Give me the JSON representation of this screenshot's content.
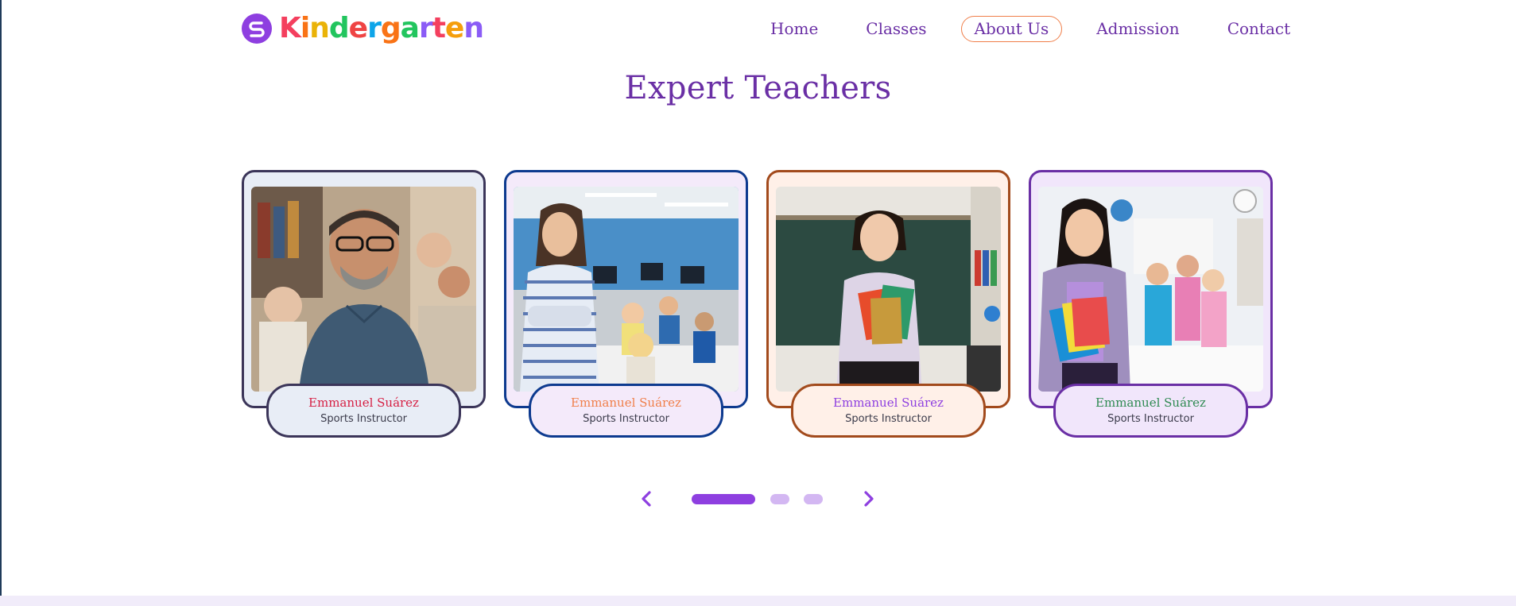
{
  "logo": {
    "letters": [
      "K",
      "i",
      "n",
      "d",
      "e",
      "r",
      "g",
      "a",
      "r",
      "t",
      "e",
      "n"
    ],
    "letter_colors": [
      "#f43f5e",
      "#f97316",
      "#eab308",
      "#22c55e",
      "#ef4444",
      "#0ea5e9",
      "#f97316",
      "#22c55e",
      "#8b5cf6",
      "#f43f5e",
      "#f59e0b",
      "#8b5cf6"
    ],
    "mark_color": "#8e3fe0",
    "mark_icon": "s-logo-icon"
  },
  "nav": {
    "items": [
      {
        "label": "Home",
        "active": false
      },
      {
        "label": "Classes",
        "active": false
      },
      {
        "label": "About Us",
        "active": true
      },
      {
        "label": "Admission",
        "active": false
      },
      {
        "label": "Contact",
        "active": false
      }
    ],
    "text_color": "#6a2fa5",
    "active_border": "#f07f4a"
  },
  "section": {
    "title": "Expert Teachers"
  },
  "teachers": [
    {
      "name": "Emmanuel Suárez",
      "role": "Sports Instructor",
      "border": "#3b3559",
      "bg": "#e8edf6",
      "name_color": "#d61f43"
    },
    {
      "name": "Emmanuel Suárez",
      "role": "Sports Instructor",
      "border": "#0d3a8f",
      "bg": "#f4eafa",
      "name_color": "#f07f4a"
    },
    {
      "name": "Emmanuel Suárez",
      "role": "Sports Instructor",
      "border": "#a24a1c",
      "bg": "#fff0e8",
      "name_color": "#8e3fe0"
    },
    {
      "name": "Emmanuel Suárez",
      "role": "Sports Instructor",
      "border": "#6a2fa5",
      "bg": "#f1e6fb",
      "name_color": "#2f8a52"
    }
  ],
  "carousel": {
    "prev_icon": "chevron-left-icon",
    "next_icon": "chevron-right-icon",
    "dots": 3,
    "active_dot": 0,
    "arrow_color": "#8e3fe0"
  }
}
